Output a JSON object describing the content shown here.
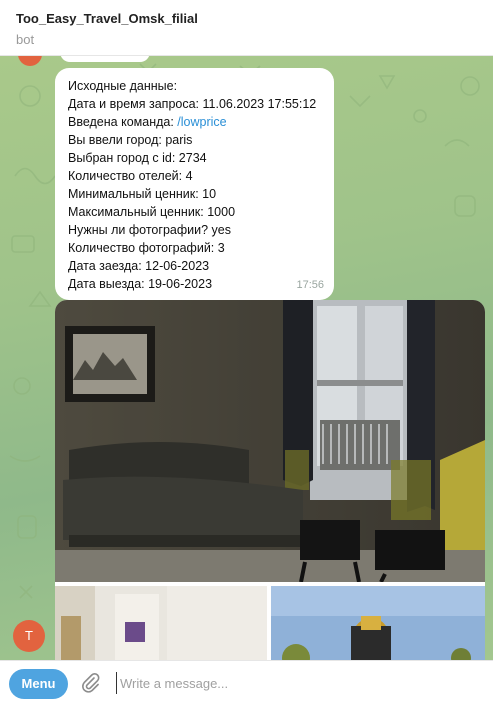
{
  "header": {
    "title": "Too_Easy_Travel_Omsk_filial",
    "subtitle": "bot"
  },
  "message": {
    "lines": [
      "Исходные данные:",
      "Дата и время запроса: 11.06.2023 17:55:12",
      "Введена команда: ",
      "Вы ввели город: paris",
      "Выбран город с id: 2734",
      "Количество отелей: 4",
      "Минимальный ценник: 10",
      "Максимальный ценник: 1000",
      "Нужны ли фотографии? yes",
      "Количество фотографий: 3",
      "Дата заезда: 12-06-2023",
      "Дата выезда: 19-06-2023"
    ],
    "command": "/lowprice",
    "time": "17:56"
  },
  "avatar": {
    "letter": "T",
    "color": "#e2633f"
  },
  "input": {
    "menu_label": "Menu",
    "placeholder": "Write a message..."
  },
  "icons": [
    "paperclip-icon"
  ],
  "colors": {
    "accent": "#4fa4e0",
    "link": "#2a8fd6",
    "chat_bg": "#9fc38a"
  }
}
